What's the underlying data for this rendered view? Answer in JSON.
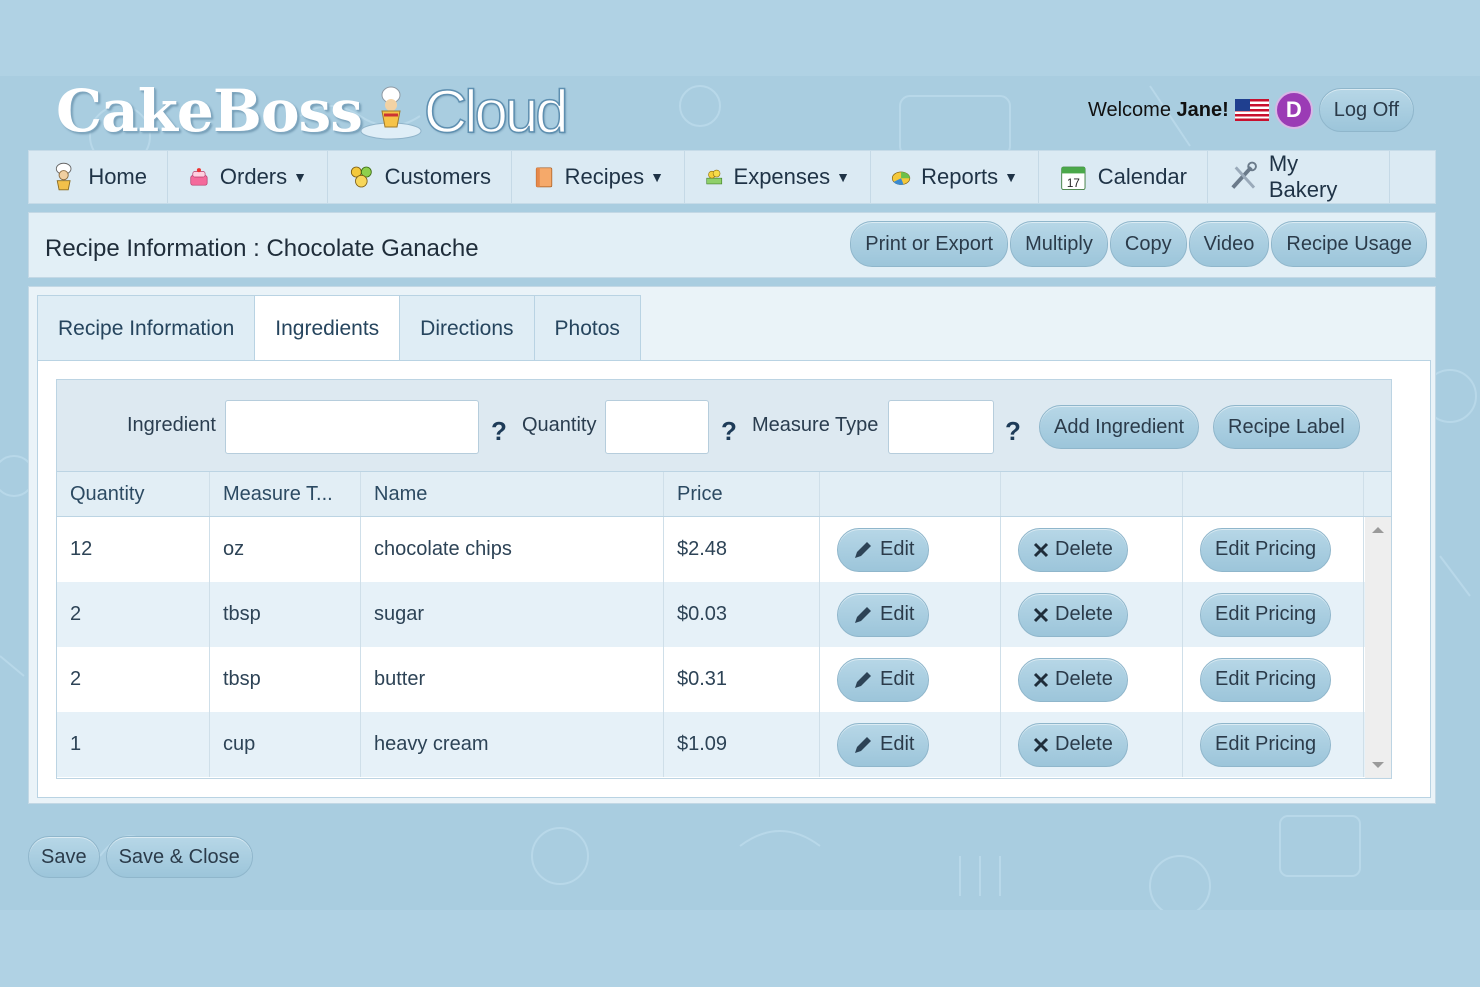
{
  "app": {
    "logo_text_left": "CakeBoss",
    "logo_text_right": "Cloud",
    "welcome_prefix": "Welcome ",
    "user_name": "Jane!",
    "avatar_letter": "D",
    "logoff_label": "Log Off"
  },
  "nav": {
    "items": [
      {
        "label": "Home",
        "icon": "chef-icon",
        "dropdown": false
      },
      {
        "label": "Orders",
        "icon": "cake-icon",
        "dropdown": true
      },
      {
        "label": "Customers",
        "icon": "people-icon",
        "dropdown": false
      },
      {
        "label": "Recipes",
        "icon": "book-icon",
        "dropdown": true
      },
      {
        "label": "Expenses",
        "icon": "money-icon",
        "dropdown": true
      },
      {
        "label": "Reports",
        "icon": "chart-icon",
        "dropdown": true
      },
      {
        "label": "Calendar",
        "icon": "calendar-icon",
        "dropdown": false
      },
      {
        "label": "My Bakery",
        "icon": "tools-icon",
        "dropdown": false
      }
    ],
    "caret": "▼",
    "calendar_day": "17"
  },
  "titlebar": {
    "title": "Recipe Information : Chocolate Ganache",
    "actions": [
      "Print or Export",
      "Multiply",
      "Copy",
      "Video",
      "Recipe Usage"
    ]
  },
  "tabs": [
    "Recipe Information",
    "Ingredients",
    "Directions",
    "Photos"
  ],
  "active_tab": "Ingredients",
  "form": {
    "ingredient_label": "Ingredient",
    "ingredient_value": "",
    "quantity_label": "Quantity",
    "quantity_value": "",
    "measure_label": "Measure Type",
    "measure_value": "",
    "help_glyph": "?",
    "add_button": "Add Ingredient",
    "label_button": "Recipe Label"
  },
  "table": {
    "headers": [
      "Quantity",
      "Measure T...",
      "Name",
      "Price"
    ],
    "rows": [
      {
        "quantity": "12",
        "measure": "oz",
        "name": "chocolate chips",
        "price": "$2.48"
      },
      {
        "quantity": "2",
        "measure": "tbsp",
        "name": "sugar",
        "price": "$0.03"
      },
      {
        "quantity": "2",
        "measure": "tbsp",
        "name": "butter",
        "price": "$0.31"
      },
      {
        "quantity": "1",
        "measure": "cup",
        "name": "heavy cream",
        "price": "$1.09"
      }
    ],
    "edit_label": "Edit",
    "delete_label": "Delete",
    "pricing_label": "Edit Pricing"
  },
  "footer": {
    "save": "Save",
    "save_close": "Save & Close"
  }
}
